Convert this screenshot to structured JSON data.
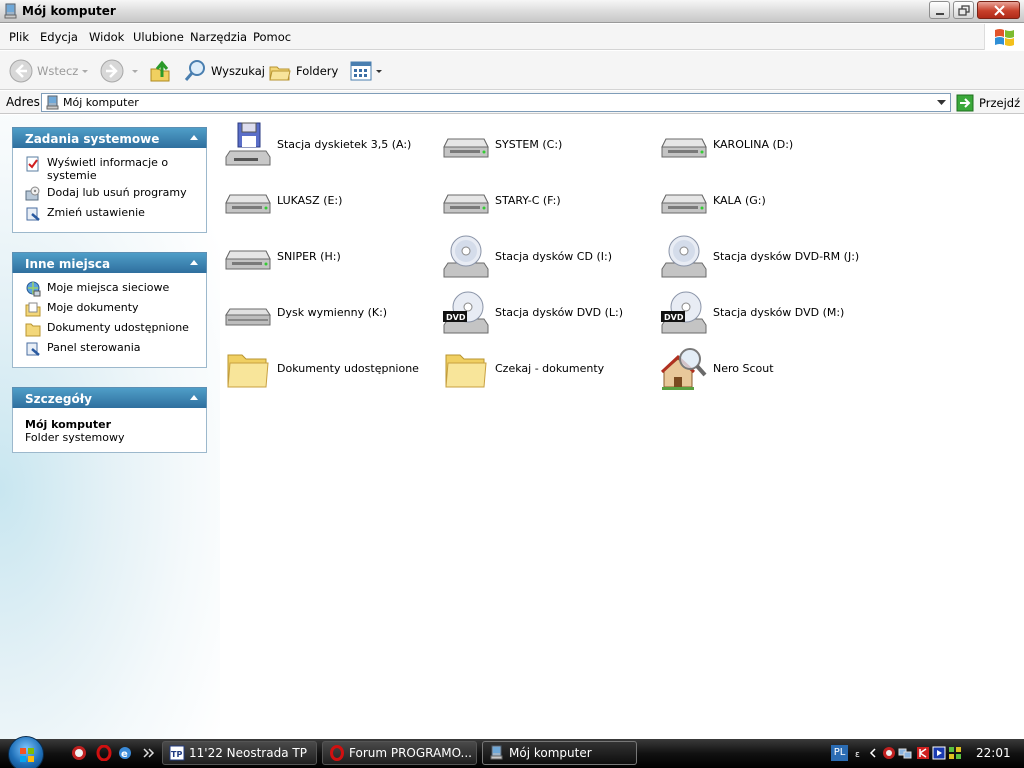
{
  "window": {
    "title": "Mój komputer"
  },
  "menu": [
    "Plik",
    "Edycja",
    "Widok",
    "Ulubione",
    "Narzędzia",
    "Pomoc"
  ],
  "toolbar": {
    "back_label": "Wstecz",
    "search_label": "Wyszukaj",
    "folders_label": "Foldery"
  },
  "address": {
    "label": "Adres",
    "value": "Mój komputer",
    "go_label": "Przejdź"
  },
  "sidebar": {
    "system_tasks": {
      "title": "Zadania systemowe",
      "items": [
        "Wyświetl informacje o systemie",
        "Dodaj lub usuń programy",
        "Zmień ustawienie"
      ]
    },
    "other_places": {
      "title": "Inne miejsca",
      "items": [
        "Moje miejsca sieciowe",
        "Moje dokumenty",
        "Dokumenty udostępnione",
        "Panel sterowania"
      ]
    },
    "details": {
      "title": "Szczegóły",
      "name": "Mój komputer",
      "type": "Folder systemowy"
    }
  },
  "items": [
    {
      "label": "Stacja dyskietek 3,5 (A:)",
      "icon": "floppy-drive-icon"
    },
    {
      "label": "SYSTEM (C:)",
      "icon": "hard-drive-icon"
    },
    {
      "label": "KAROLINA (D:)",
      "icon": "hard-drive-icon"
    },
    {
      "label": "LUKASZ (E:)",
      "icon": "hard-drive-icon"
    },
    {
      "label": "STARY-C (F:)",
      "icon": "hard-drive-icon"
    },
    {
      "label": "KALA (G:)",
      "icon": "hard-drive-icon"
    },
    {
      "label": "SNIPER (H:)",
      "icon": "hard-drive-icon"
    },
    {
      "label": "Stacja dysków CD (I:)",
      "icon": "cd-drive-icon"
    },
    {
      "label": "Stacja dysków DVD-RM (J:)",
      "icon": "cd-drive-icon"
    },
    {
      "label": "Dysk wymienny (K:)",
      "icon": "removable-disk-icon"
    },
    {
      "label": "Stacja dysków DVD (L:)",
      "icon": "dvd-drive-icon"
    },
    {
      "label": "Stacja dysków DVD (M:)",
      "icon": "dvd-drive-icon"
    },
    {
      "label": "Dokumenty udostępnione",
      "icon": "folder-icon"
    },
    {
      "label": "Czekaj - dokumenty",
      "icon": "folder-icon"
    },
    {
      "label": "Nero Scout",
      "icon": "nero-scout-icon"
    }
  ],
  "taskbar": {
    "buttons": [
      "11'22 Neostrada TP",
      "Forum PROGRAMO...",
      "Mój komputer"
    ],
    "language": "PL",
    "clock": "22:01"
  },
  "colors": {
    "panel_header": "#2f6f9e",
    "taskbar": "#111111",
    "close_button": "#c8402b"
  }
}
